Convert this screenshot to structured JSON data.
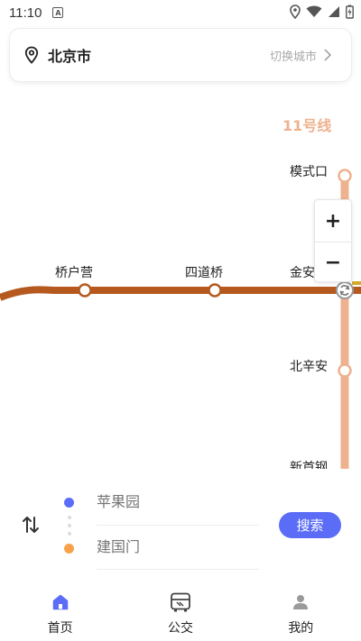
{
  "status_bar": {
    "time": "11:10"
  },
  "city": {
    "name": "北京市",
    "switch_label": "切换城市"
  },
  "map": {
    "line_name": "11号线",
    "line_color": "#eeb28f",
    "main_line_color": "#b5591f",
    "stations": {
      "moshikou": "模式口",
      "qiaohuying": "桥户营",
      "sidaoqiao": "四道桥",
      "jinanqiao": "金安桥",
      "beixinan": "北辛安",
      "xinshougang": "新首钢"
    },
    "zoom_in": "+",
    "zoom_out": "−"
  },
  "route": {
    "start_placeholder": "苹果园",
    "end_placeholder": "建国门",
    "search_label": "搜索",
    "start_color": "#5b6df6",
    "end_color": "#f7a24a"
  },
  "nav": {
    "active_color": "#5b6df6",
    "items": [
      {
        "label": "首页",
        "icon": "home-icon"
      },
      {
        "label": "公交",
        "icon": "bus-icon"
      },
      {
        "label": "我的",
        "icon": "user-icon"
      }
    ]
  }
}
